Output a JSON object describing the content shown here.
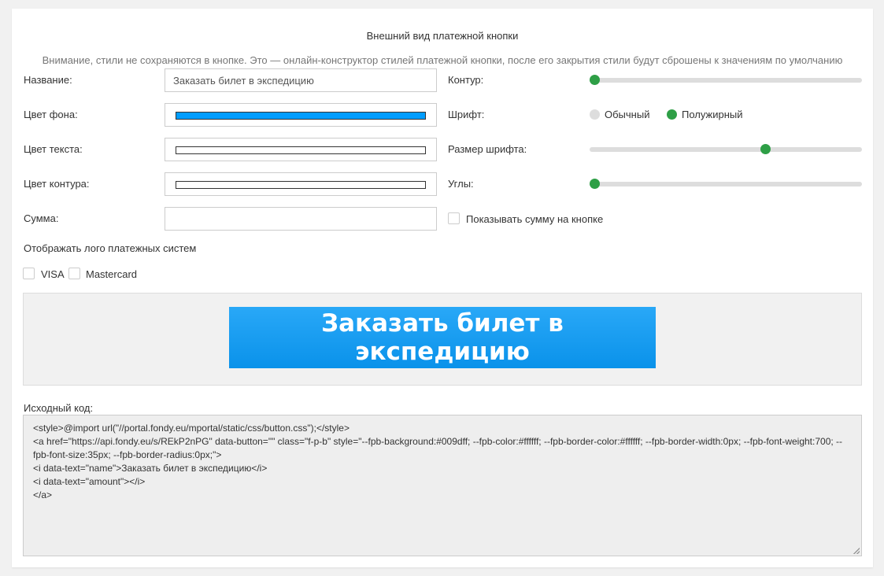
{
  "header": {
    "title": "Внешний вид платежной кнопки",
    "notice": "Внимание, стили не сохраняются в кнопке. Это — онлайн-конструктор стилей платежной кнопки, после его закрытия стили будут сброшены к значениям по умолчанию"
  },
  "form": {
    "name_label": "Название:",
    "name_value": "Заказать билет в экспедицию",
    "bg_label": "Цвет фона:",
    "bg_color": "#009dff",
    "text_color_label": "Цвет текста:",
    "text_color": "#ffffff",
    "border_color_label": "Цвет контура:",
    "border_color": "#ffffff",
    "amount_label": "Сумма:",
    "amount_value": "",
    "border_width_label": "Контур:",
    "border_width_fraction": 0.0,
    "font_label": "Шрифт:",
    "font_options": [
      "Обычный",
      "Полужирный"
    ],
    "font_selected": "Полужирный",
    "font_size_label": "Размер шрифта:",
    "font_size_fraction": 0.65,
    "radius_label": "Углы:",
    "radius_fraction": 0.0,
    "show_amount_label": "Показывать сумму на кнопке",
    "logos_label": "Отображать лого платежных систем",
    "logo_options": [
      "VISA",
      "Mastercard"
    ]
  },
  "preview": {
    "button_text": "Заказать билет в экспедицию"
  },
  "code": {
    "label": "Исходный код:",
    "lines": [
      "<style>@import url(\"//portal.fondy.eu/mportal/static/css/button.css\");</style>",
      "<a href=\"https://api.fondy.eu/s/REkP2nPG\" data-button=\"\" class=\"f-p-b\" style=\"--fpb-background:#009dff; --fpb-color:#ffffff; --fpb-border-color:#ffffff; --fpb-border-width:0px; --fpb-font-weight:700; --fpb-font-size:35px; --fpb-border-radius:0px;\">",
      "<i data-text=\"name\">Заказать билет в экспедицию</i>",
      "<i data-text=\"amount\"></i>",
      "</a>"
    ]
  },
  "colors": {
    "accent_green": "#2e9f46",
    "preview_bg": "#f1f1f1"
  }
}
